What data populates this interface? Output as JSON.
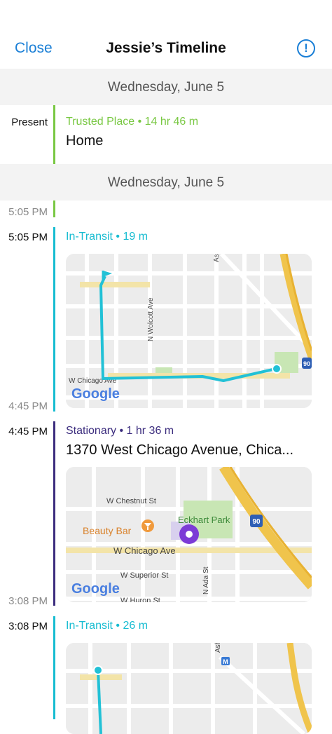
{
  "header": {
    "close_label": "Close",
    "title": "Jessie’s Timeline",
    "info_glyph": "!"
  },
  "date_bands": [
    "Wednesday, June 5",
    "Wednesday, June 5"
  ],
  "entries": [
    {
      "time_start": "Present",
      "type_label": "Trusted Place • 14 hr 46 m",
      "place": "Home",
      "color": "#79c843"
    },
    {
      "time_end": "5:05 PM"
    },
    {
      "time_start": "5:05 PM",
      "time_end": "4:45 PM",
      "type_label": "In-Transit • 19 m",
      "color": "#17bcd1",
      "map": {
        "streets": [
          "W Chicago Ave",
          "N Wolcott Ave",
          "Ash"
        ],
        "highway": "90",
        "logo": "Google"
      }
    },
    {
      "time_start": "4:45 PM",
      "time_end": "3:08 PM",
      "type_label": "Stationary • 1 hr 36 m",
      "place": "1370 West Chicago Avenue, Chica...",
      "color": "#3c2d7e",
      "map": {
        "streets": [
          "W Chestnut St",
          "W Chicago Ave",
          "W Superior St",
          "W Huron St",
          "N Ada St"
        ],
        "poi_park": "Eckhart Park",
        "poi_bar": "Beauty Bar",
        "highway": "90",
        "logo": "Google"
      }
    },
    {
      "time_start": "3:08 PM",
      "type_label": "In-Transit • 26 m",
      "color": "#17bcd1",
      "map": {
        "streets": [
          "Ash"
        ]
      }
    }
  ],
  "icons": [
    "info-icon",
    "flag-icon",
    "location-pin-icon",
    "cocktail-icon",
    "metro-icon",
    "highway-shield-icon"
  ]
}
